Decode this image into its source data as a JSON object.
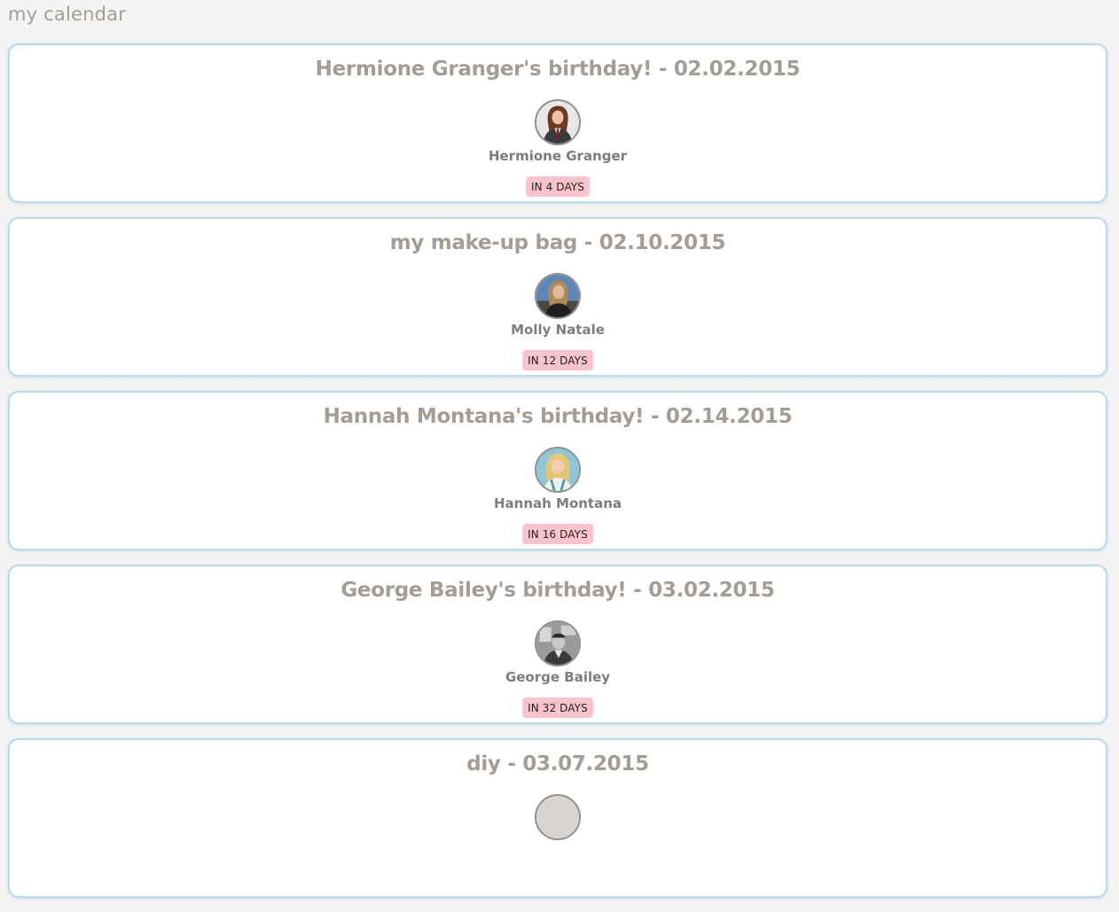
{
  "app": {
    "title": "my calendar"
  },
  "events": [
    {
      "title": "Hermione Granger's birthday! - 02.02.2015",
      "person": "Hermione Granger",
      "countdown": "IN 4 DAYS",
      "avatar_icon": "hermione-avatar"
    },
    {
      "title": "my make-up bag - 02.10.2015",
      "person": "Molly Natale",
      "countdown": "IN 12 DAYS",
      "avatar_icon": "molly-avatar"
    },
    {
      "title": "Hannah Montana's birthday! - 02.14.2015",
      "person": "Hannah Montana",
      "countdown": "IN 16 DAYS",
      "avatar_icon": "hannah-avatar"
    },
    {
      "title": "George Bailey's birthday! - 03.02.2015",
      "person": "George Bailey",
      "countdown": "IN 32 DAYS",
      "avatar_icon": "george-avatar"
    },
    {
      "title": "diy - 03.07.2015",
      "person": "",
      "countdown": "",
      "avatar_icon": "diy-avatar"
    }
  ],
  "colors": {
    "background": "#f4f4f4",
    "card_border": "#b7dbe8",
    "title_text": "#a49d95",
    "name_text": "#7d7d7d",
    "badge_bg": "#fbc4cc"
  }
}
